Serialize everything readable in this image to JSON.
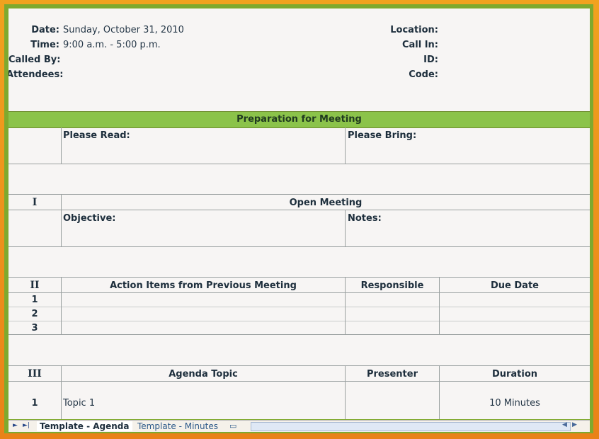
{
  "header": {
    "date_label": "Date:",
    "date_value": "Sunday, October 31, 2010",
    "time_label": "Time:",
    "time_value": "9:00 a.m. - 5:00 p.m.",
    "called_by_label": "Called By:",
    "attendees_label": "Attendees:",
    "location_label": "Location:",
    "call_in_label": "Call In:",
    "id_label": "ID:",
    "code_label": "Code:"
  },
  "prep": {
    "title": "Preparation for Meeting",
    "please_read": "Please Read:",
    "please_bring": "Please Bring:"
  },
  "open_meeting": {
    "numeral": "I",
    "title": "Open Meeting",
    "objective": "Objective:",
    "notes": "Notes:"
  },
  "action_items": {
    "numeral": "II",
    "col_title": "Action Items from Previous Meeting",
    "col_responsible": "Responsible",
    "col_due": "Due Date",
    "rows": [
      "1",
      "2",
      "3"
    ]
  },
  "agenda": {
    "numeral": "III",
    "col_topic": "Agenda Topic",
    "col_presenter": "Presenter",
    "col_duration": "Duration",
    "row_num": "1",
    "row_topic": "Topic 1",
    "row_duration": "10 Minutes"
  },
  "tabs": {
    "active": "Template - Agenda",
    "inactive": "Template - Minutes"
  },
  "colors": {
    "frame": "#ea8a18",
    "band": "#8bc34a",
    "sheet": "#f7f5f4"
  }
}
